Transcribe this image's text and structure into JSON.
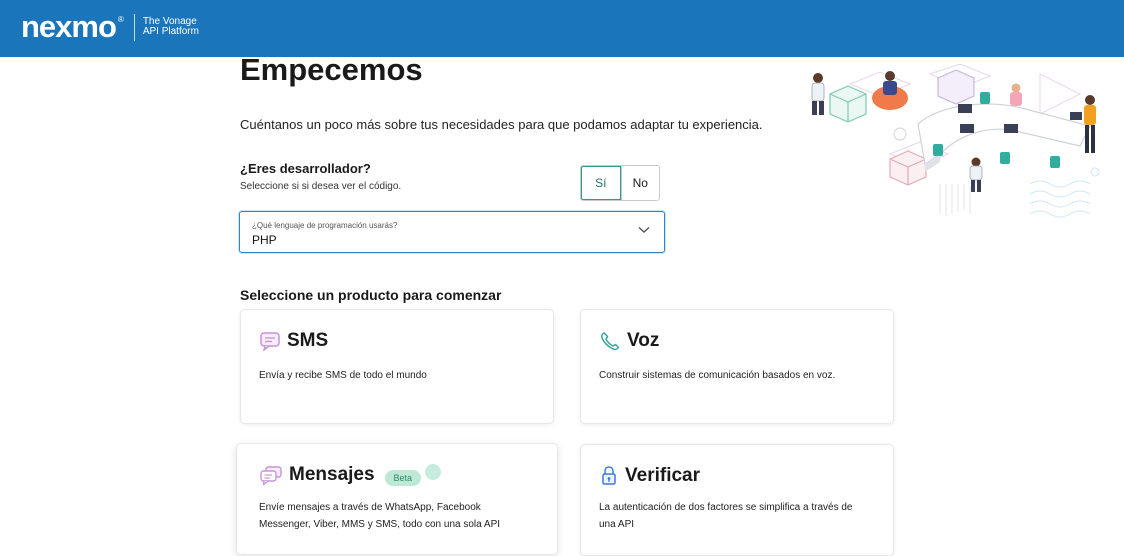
{
  "header": {
    "logo_text": "nexmo",
    "logo_mark": "®",
    "platform_line1": "The Vonage",
    "platform_line2": "API Platform"
  },
  "page": {
    "title": "Empecemos",
    "subtitle": "Cuéntanos un poco más sobre tus necesidades para que podamos adaptar tu experiencia."
  },
  "developer": {
    "question": "¿Eres desarrollador?",
    "help": "Seleccione si si desea ver el código.",
    "yes_label": "Sí",
    "no_label": "No",
    "selected": "Sí"
  },
  "language_select": {
    "label": "¿Qué lenguaje de programación usarás?",
    "value": "PHP"
  },
  "products": {
    "heading": "Seleccione un producto para comenzar",
    "sms": {
      "title": "SMS",
      "description": "Envía y recibe SMS de todo el mundo",
      "icon": "message-icon"
    },
    "voice": {
      "title": "Voz",
      "description": "Construir sistemas de comunicación basados en voz.",
      "icon": "phone-icon"
    },
    "messages": {
      "title": "Mensajes",
      "badge": "Beta",
      "description_line1": "Envíe mensajes a través de WhatsApp, Facebook",
      "description_line2": "Messenger, Viber, MMS y SMS, todo con una sola API",
      "icon": "chat-bubbles-icon"
    },
    "verify": {
      "title": "Verificar",
      "description_line1": "La autenticación de dos factores se simplifica a través de",
      "description_line2": "una API",
      "icon": "lock-icon"
    }
  },
  "colors": {
    "topbar": "#1b75bb",
    "toggle_active": "#2f9b8c",
    "select_focus": "#2b86c8",
    "sms_icon": "#c794d8",
    "voice_icon": "#3aa59a",
    "verify_icon": "#3a7bd5",
    "beta_bg": "#bde8d5"
  }
}
